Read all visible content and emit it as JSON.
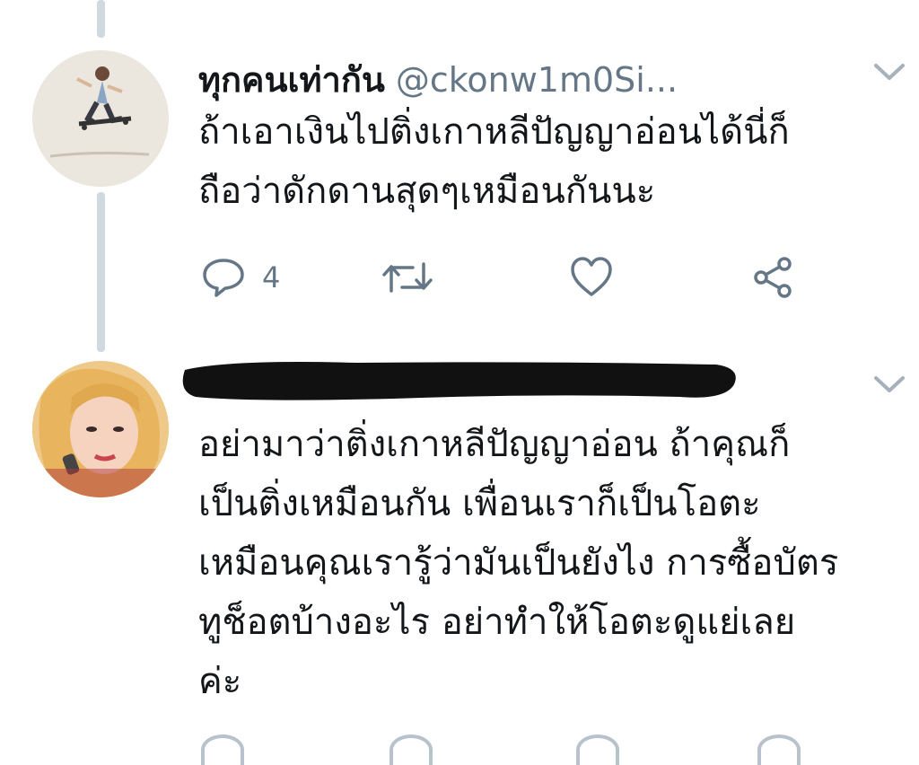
{
  "tweet1": {
    "display_name": "ทุกคนเท่ากัน",
    "handle": "@ckonw1m0Si...",
    "text": "ถ้าเอาเงินไปติ่งเกาหลีปัญญาอ่อนได้นี่ก็\nถือว่าดักดานสุดๆเหมือนกันนะ",
    "reply_count": "4"
  },
  "tweet2": {
    "text": "อย่ามาว่าติ่งเกาหลีปัญญาอ่อน ถ้าคุณก็\nเป็นติ่งเหมือนกัน เพื่อนเราก็เป็นโอตะ\nเหมือนคุณเรารู้ว่ามันเป็นยังไง การซื้อบัตร\nทูช็อตบ้างอะไร อย่าทำให้โอตะดูแย่เลย\nค่ะ"
  },
  "icons": {
    "reply": "reply-icon",
    "retweet": "retweet-icon",
    "like": "heart-icon",
    "share": "share-icon",
    "menu": "chevron-down-icon"
  },
  "colors": {
    "text": "#14171a",
    "secondary": "#657786",
    "thread_line": "#cfd9de",
    "redaction": "#111111"
  }
}
